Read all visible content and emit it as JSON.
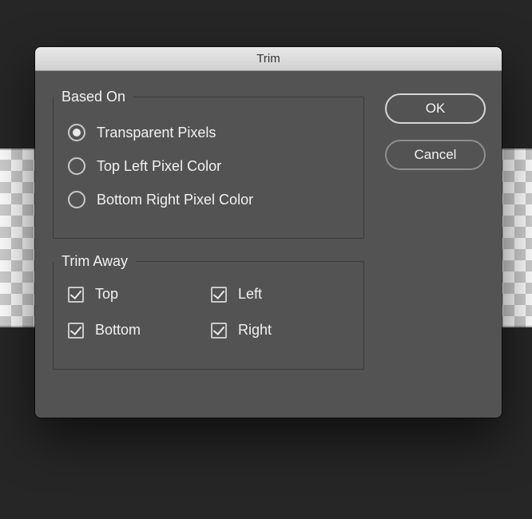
{
  "dialog": {
    "title": "Trim",
    "based_on": {
      "legend": "Based On",
      "selected": "transparent",
      "options": {
        "transparent": "Transparent Pixels",
        "top_left": "Top Left Pixel Color",
        "bot_right": "Bottom Right Pixel Color"
      }
    },
    "trim_away": {
      "legend": "Trim Away",
      "top": {
        "label": "Top",
        "checked": true
      },
      "left": {
        "label": "Left",
        "checked": true
      },
      "bottom": {
        "label": "Bottom",
        "checked": true
      },
      "right": {
        "label": "Right",
        "checked": true
      }
    },
    "buttons": {
      "ok": "OK",
      "cancel": "Cancel"
    }
  }
}
